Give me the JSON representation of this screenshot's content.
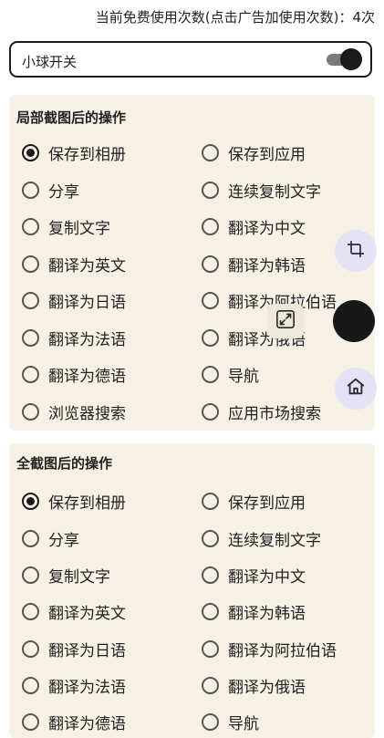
{
  "usage_text": "当前免费使用次数(点击广告加使用次数)：4次",
  "ball_toggle": {
    "label": "小球开关",
    "on": true
  },
  "partial_section": {
    "title": "局部截图后的操作",
    "options": [
      {
        "label": "保存到相册",
        "selected": true
      },
      {
        "label": "保存到应用",
        "selected": false
      },
      {
        "label": "分享",
        "selected": false
      },
      {
        "label": "连续复制文字",
        "selected": false
      },
      {
        "label": "复制文字",
        "selected": false
      },
      {
        "label": "翻译为中文",
        "selected": false
      },
      {
        "label": "翻译为英文",
        "selected": false
      },
      {
        "label": "翻译为韩语",
        "selected": false
      },
      {
        "label": "翻译为日语",
        "selected": false
      },
      {
        "label": "翻译为阿拉伯语",
        "selected": false
      },
      {
        "label": "翻译为法语",
        "selected": false
      },
      {
        "label": "翻译为俄语",
        "selected": false
      },
      {
        "label": "翻译为德语",
        "selected": false
      },
      {
        "label": "导航",
        "selected": false
      },
      {
        "label": "浏览器搜索",
        "selected": false
      },
      {
        "label": "应用市场搜索",
        "selected": false
      }
    ]
  },
  "full_section": {
    "title": "全截图后的操作",
    "options": [
      {
        "label": "保存到相册",
        "selected": true
      },
      {
        "label": "保存到应用",
        "selected": false
      },
      {
        "label": "分享",
        "selected": false
      },
      {
        "label": "连续复制文字",
        "selected": false
      },
      {
        "label": "复制文字",
        "selected": false
      },
      {
        "label": "翻译为中文",
        "selected": false
      },
      {
        "label": "翻译为英文",
        "selected": false
      },
      {
        "label": "翻译为韩语",
        "selected": false
      },
      {
        "label": "翻译为日语",
        "selected": false
      },
      {
        "label": "翻译为阿拉伯语",
        "selected": false
      },
      {
        "label": "翻译为法语",
        "selected": false
      },
      {
        "label": "翻译为俄语",
        "selected": false
      },
      {
        "label": "翻译为德语",
        "selected": false
      },
      {
        "label": "导航",
        "selected": false
      }
    ]
  },
  "floating_buttons": [
    {
      "name": "crop-icon"
    },
    {
      "name": "expand-icon"
    },
    {
      "name": "floating-ball"
    },
    {
      "name": "home-icon"
    }
  ]
}
